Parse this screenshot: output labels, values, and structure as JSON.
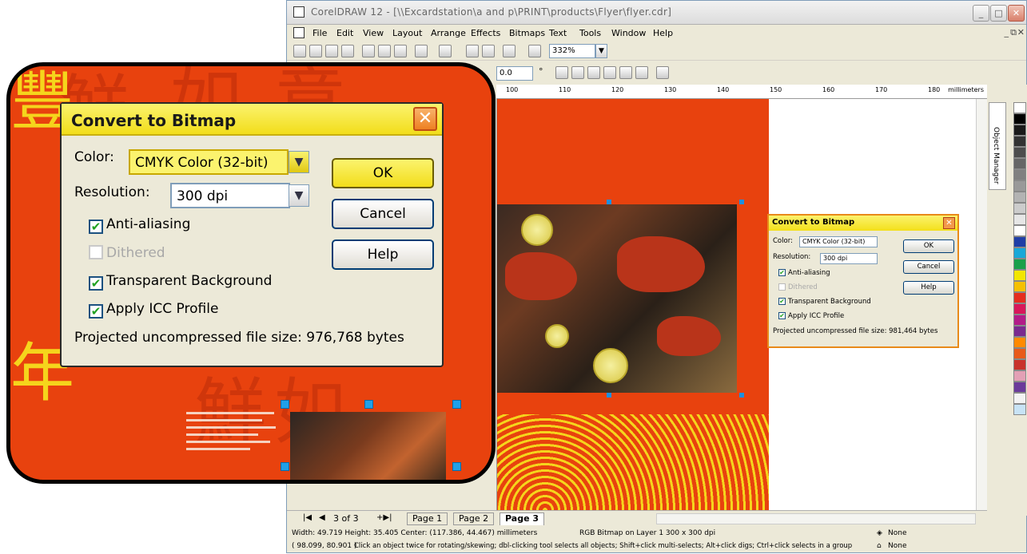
{
  "window": {
    "title": "CorelDRAW 12 - [\\\\Excardstation\\a and p\\PRINT\\products\\Flyer\\flyer.cdr]"
  },
  "menu": [
    "File",
    "Edit",
    "View",
    "Layout",
    "Arrange",
    "Effects",
    "Bitmaps",
    "Text",
    "Tools",
    "Window",
    "Help"
  ],
  "toolbar": {
    "zoom_value": "332%",
    "angle_value": "0.0",
    "degree_symbol": "°"
  },
  "ruler": {
    "ticks": [
      "100",
      "110",
      "120",
      "130",
      "140",
      "150",
      "160",
      "170",
      "180"
    ],
    "unit": "millimeters"
  },
  "docker": {
    "label": "Object Manager"
  },
  "page_nav": {
    "page_count": "3 of 3",
    "tabs": [
      "Page 1",
      "Page 2",
      "Page 3"
    ],
    "active_tab": "Page 3"
  },
  "status": {
    "dimensions": "Width: 49.719  Height: 35.405  Center: (117.386, 44.467)  millimeters",
    "object_info": "RGB Bitmap on Layer 1 300 x 300 dpi",
    "fill": "None",
    "coords": "( 98.099, 80.901 )",
    "hint": "Click an object twice for rotating/skewing; dbl-clicking tool selects all objects; Shift+click multi-selects; Alt+click digs; Ctrl+click selects in a group",
    "outline": "None"
  },
  "dialog_small": {
    "title": "Convert to Bitmap",
    "color_label": "Color:",
    "color_value": "CMYK Color (32-bit)",
    "resolution_label": "Resolution:",
    "resolution_value": "300 dpi",
    "ok": "OK",
    "cancel": "Cancel",
    "help": "Help",
    "anti_aliasing": "Anti-aliasing",
    "dithered": "Dithered",
    "transparent_bg": "Transparent Background",
    "apply_icc": "Apply ICC Profile",
    "file_size": "Projected uncompressed file size: 981,464 bytes"
  },
  "dialog_big": {
    "title": "Convert to Bitmap",
    "color_label": "Color:",
    "color_value": "CMYK Color (32-bit)",
    "resolution_label": "Resolution:",
    "resolution_value": "300 dpi",
    "ok": "OK",
    "cancel": "Cancel",
    "help": "Help",
    "anti_aliasing": "Anti-aliasing",
    "dithered": "Dithered",
    "transparent_bg": "Transparent Background",
    "apply_icc": "Apply ICC Profile",
    "file_size": "Projected uncompressed file size: 976,768 bytes"
  },
  "palette_colors": [
    "#ffffff",
    "#000000",
    "#1a1a1a",
    "#333333",
    "#4d4d4d",
    "#666666",
    "#808080",
    "#999999",
    "#b3b3b3",
    "#cccccc",
    "#e6e6e6",
    "#ffffff",
    "#1f3ea6",
    "#3d6ad6",
    "#19a8d8",
    "#19a04a",
    "#f2e600",
    "#f5c000",
    "#e52d1e",
    "#d8175a",
    "#b21c88",
    "#7a2a8f",
    "#5d1f7a",
    "#ff8a00",
    "#e85a1a",
    "#c8322a",
    "#e3a0b5",
    "#6a3a9a",
    "#f3f3f3",
    "#e6e6e6",
    "#c8e3f5"
  ]
}
